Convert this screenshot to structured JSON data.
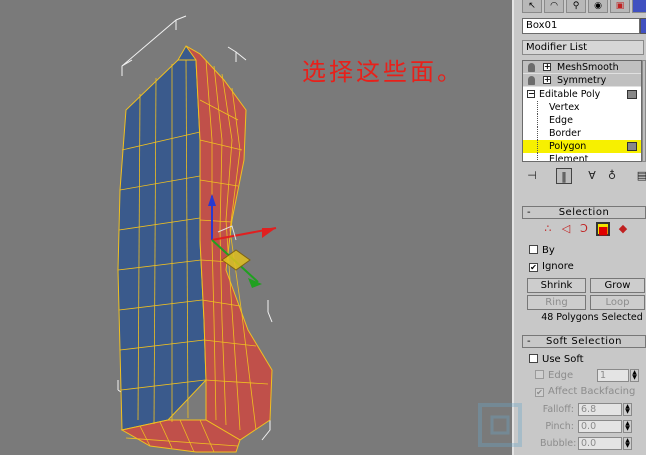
{
  "annotation": "选择这些面。",
  "panel": {
    "object_name": "Box01",
    "modifier_list_label": "Modifier List",
    "stack": [
      {
        "label": "MeshSmooth",
        "kind": "modifier"
      },
      {
        "label": "Symmetry",
        "kind": "modifier"
      },
      {
        "label": "Editable Poly",
        "kind": "base"
      },
      {
        "label": "Vertex",
        "kind": "sub"
      },
      {
        "label": "Edge",
        "kind": "sub"
      },
      {
        "label": "Border",
        "kind": "sub"
      },
      {
        "label": "Polygon",
        "kind": "sub",
        "selected": true
      },
      {
        "label": "Element",
        "kind": "sub"
      }
    ],
    "selection": {
      "title": "Selection",
      "by_label": "By",
      "ignore_label": "Ignore",
      "ignore_checked": "✔",
      "shrink_label": "Shrink",
      "grow_label": "Grow",
      "ring_label": "Ring",
      "loop_label": "Loop",
      "status": "48 Polygons Selected"
    },
    "soft_selection": {
      "title": "Soft Selection",
      "use_soft_label": "Use Soft",
      "edge_label": "Edge",
      "edge_value": "1",
      "affect_backfacing_label": "Affect Backfacing",
      "falloff_label": "Falloff:",
      "falloff_value": "6.8",
      "pinch_label": "Pinch:",
      "pinch_value": "0.0",
      "bubble_label": "Bubble:",
      "bubble_value": "0.0"
    },
    "minus": "-"
  },
  "colors": {
    "viewport_bg": "#7a7a7a",
    "face_blue": "#3a5a8c",
    "face_red": "#c0504a",
    "wire": "#f0c020",
    "annotation": "#e8201a",
    "selection_highlight": "#f7f000"
  }
}
